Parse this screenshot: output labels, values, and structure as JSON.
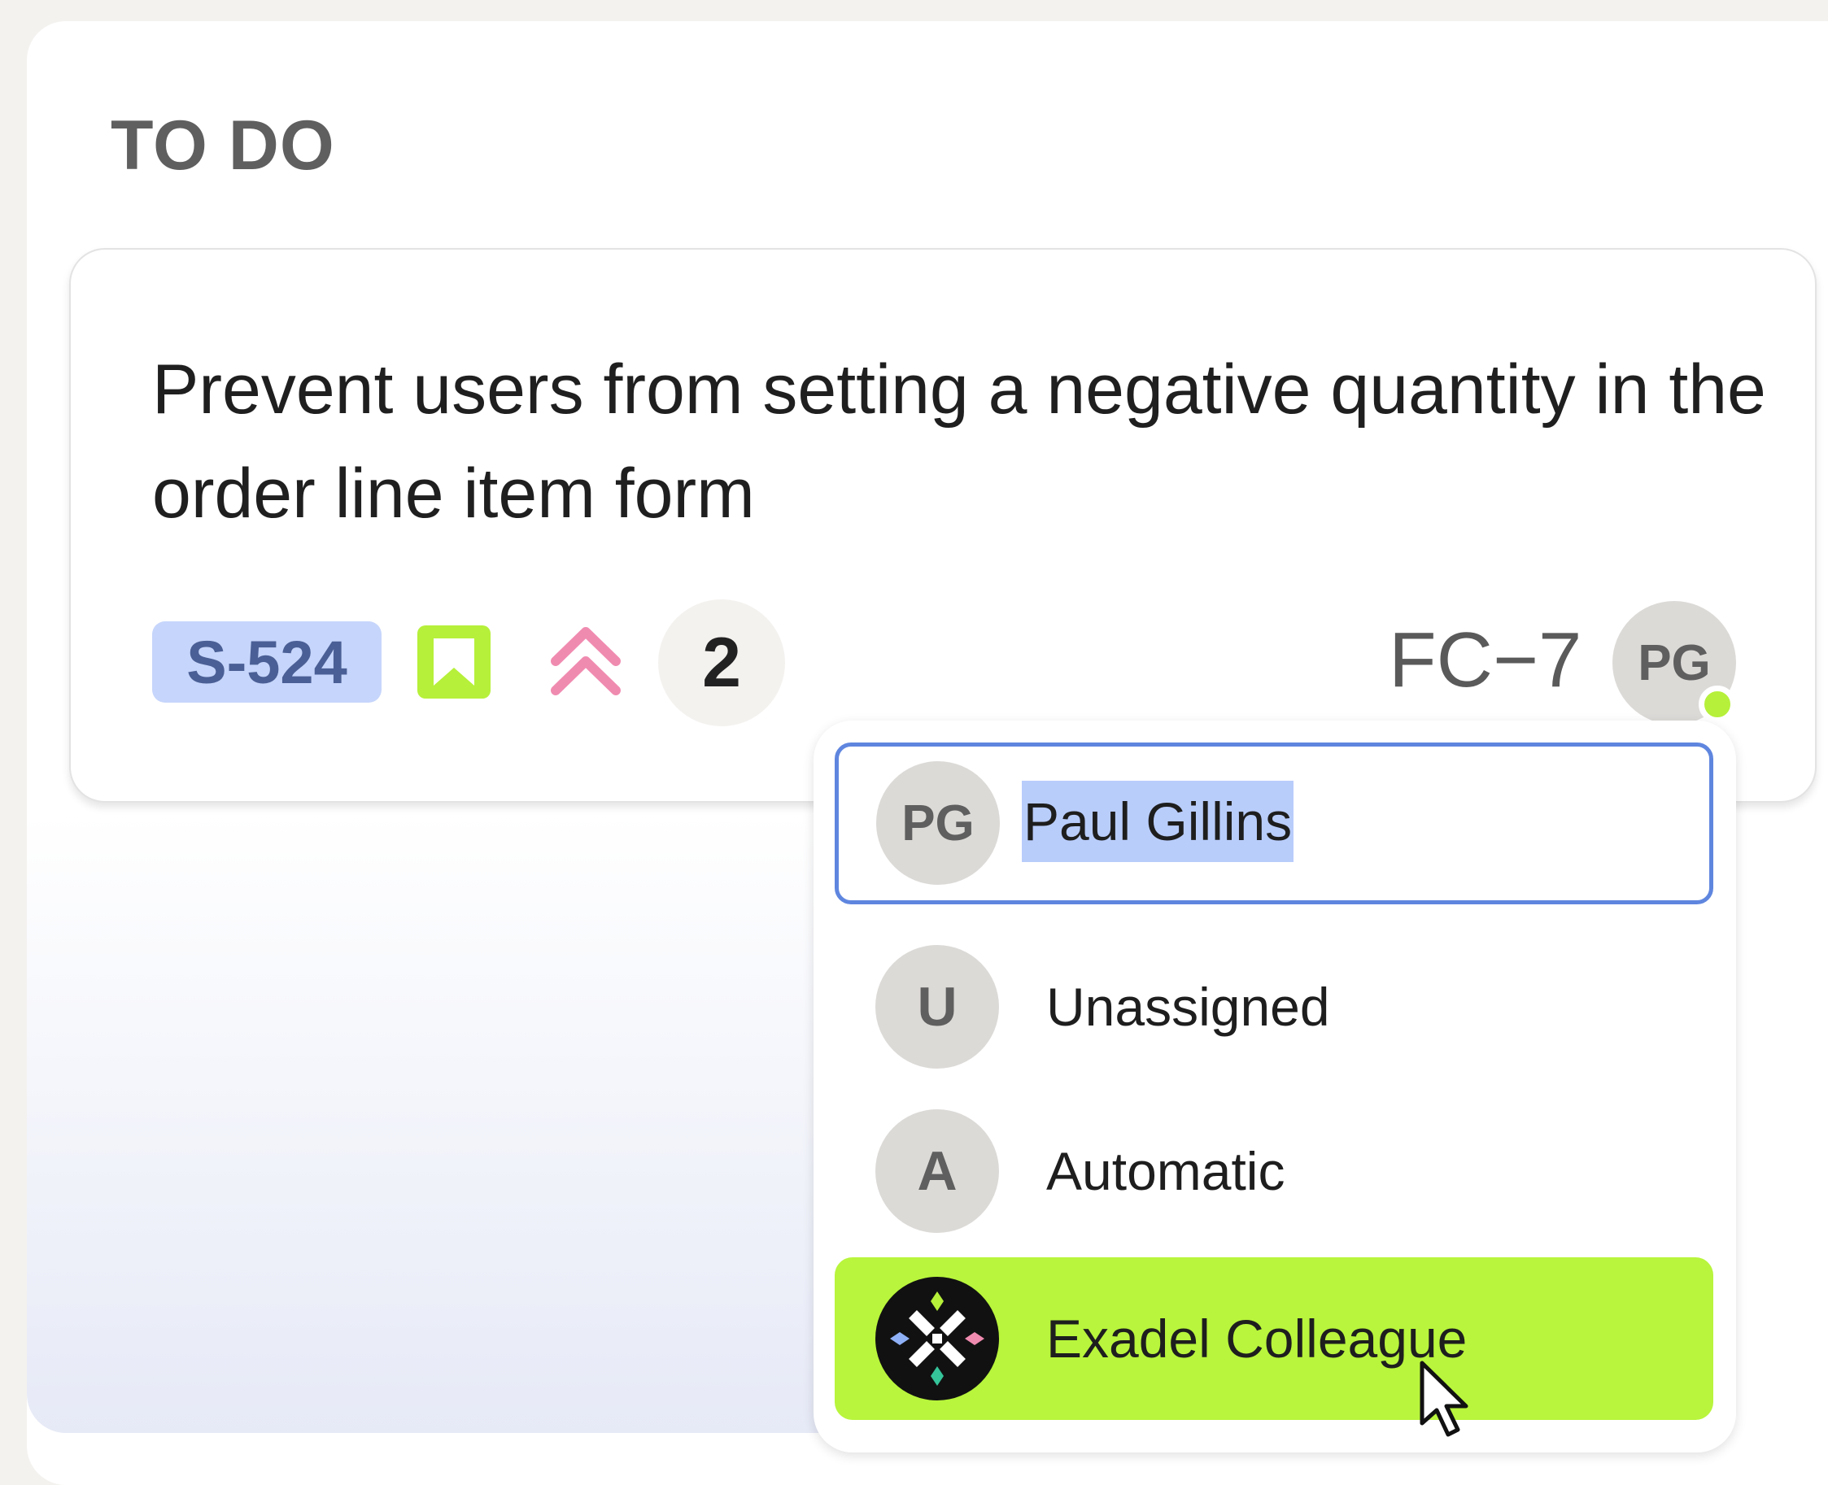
{
  "column": {
    "title": "TO DO"
  },
  "card": {
    "title": "Prevent users from setting a negative quantity in the order line item form",
    "key": "S-524",
    "type_icon": "story-bookmark-icon",
    "priority_icon": "priority-highest-icon",
    "count": "2",
    "reference": "FC−7",
    "assignee_initials": "PG",
    "assignee_status": "online",
    "colors": {
      "key_badge_bg": "#c6d5fb",
      "story_icon": "#b6f03a",
      "priority_icon": "#f08bb0",
      "status_dot": "#b6f03a"
    }
  },
  "assignee_dropdown": {
    "search": {
      "avatar_initials": "PG",
      "value": "Paul Gillins"
    },
    "options": [
      {
        "avatar": "U",
        "label": "Unassigned",
        "highlighted": false
      },
      {
        "avatar": "A",
        "label": "Automatic",
        "highlighted": false
      },
      {
        "avatar": "exadel-logo-icon",
        "label": "Exadel Colleague",
        "highlighted": true
      }
    ],
    "colors": {
      "field_border": "#5f86df",
      "selection": "#b9cdfb",
      "highlight": "#b8f53c"
    }
  }
}
